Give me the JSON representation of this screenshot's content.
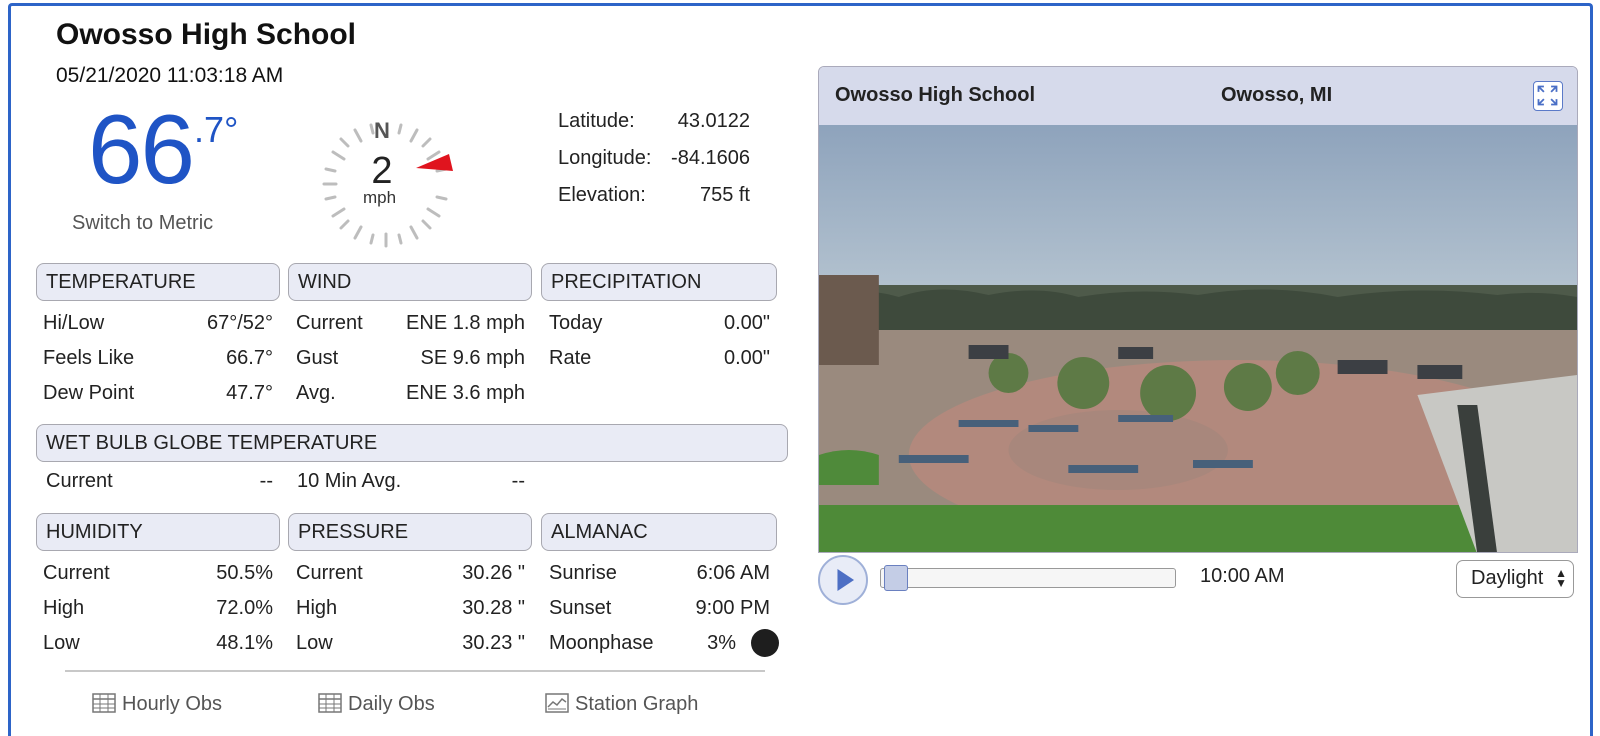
{
  "station": {
    "title": "Owosso High School",
    "timestamp": "05/21/2020 11:03:18 AM"
  },
  "current": {
    "temp_whole": "66",
    "temp_decimal": ".7°",
    "switch_label": "Switch to Metric",
    "wind_speed": "2",
    "wind_unit": "mph",
    "compass_north": "N"
  },
  "location": {
    "latitude_label": "Latitude:",
    "latitude": "43.0122",
    "longitude_label": "Longitude:",
    "longitude": "-84.1606",
    "elevation_label": "Elevation:",
    "elevation": "755 ft"
  },
  "temperature": {
    "heading": "TEMPERATURE",
    "rows": [
      {
        "label": "Hi/Low",
        "value": "67°/52°"
      },
      {
        "label": "Feels Like",
        "value": "66.7°"
      },
      {
        "label": "Dew Point",
        "value": "47.7°"
      }
    ]
  },
  "wind": {
    "heading": "WIND",
    "rows": [
      {
        "label": "Current",
        "value": "ENE 1.8 mph"
      },
      {
        "label": "Gust",
        "value": "SE 9.6 mph"
      },
      {
        "label": "Avg.",
        "value": "ENE 3.6 mph"
      }
    ]
  },
  "precipitation": {
    "heading": "PRECIPITATION",
    "rows": [
      {
        "label": "Today",
        "value": "0.00\""
      },
      {
        "label": "Rate",
        "value": "0.00\""
      }
    ]
  },
  "wbgt": {
    "heading": "WET BULB GLOBE TEMPERATURE",
    "current_label": "Current",
    "current_value": "--",
    "avg_label": "10 Min Avg.",
    "avg_value": "--"
  },
  "humidity": {
    "heading": "HUMIDITY",
    "rows": [
      {
        "label": "Current",
        "value": "50.5%"
      },
      {
        "label": "High",
        "value": "72.0%"
      },
      {
        "label": "Low",
        "value": "48.1%"
      }
    ]
  },
  "pressure": {
    "heading": "PRESSURE",
    "rows": [
      {
        "label": "Current",
        "value": "30.26 \""
      },
      {
        "label": "High",
        "value": "30.28 \""
      },
      {
        "label": "Low",
        "value": "30.23 \""
      }
    ]
  },
  "almanac": {
    "heading": "ALMANAC",
    "rows": [
      {
        "label": "Sunrise",
        "value": "6:06 AM"
      },
      {
        "label": "Sunset",
        "value": "9:00 PM"
      },
      {
        "label": "Moonphase",
        "value": "3%"
      }
    ]
  },
  "links": {
    "hourly": "Hourly Obs",
    "daily": "Daily Obs",
    "graph": "Station Graph"
  },
  "camera": {
    "title": "Owosso High School",
    "location": "Owosso, MI",
    "time": "10:00 AM",
    "mode": "Daylight",
    "playback_fraction": 0
  },
  "colors": {
    "accent": "#1f54c5",
    "frame": "#2d64c8",
    "wind_arrow": "#e0141e"
  }
}
